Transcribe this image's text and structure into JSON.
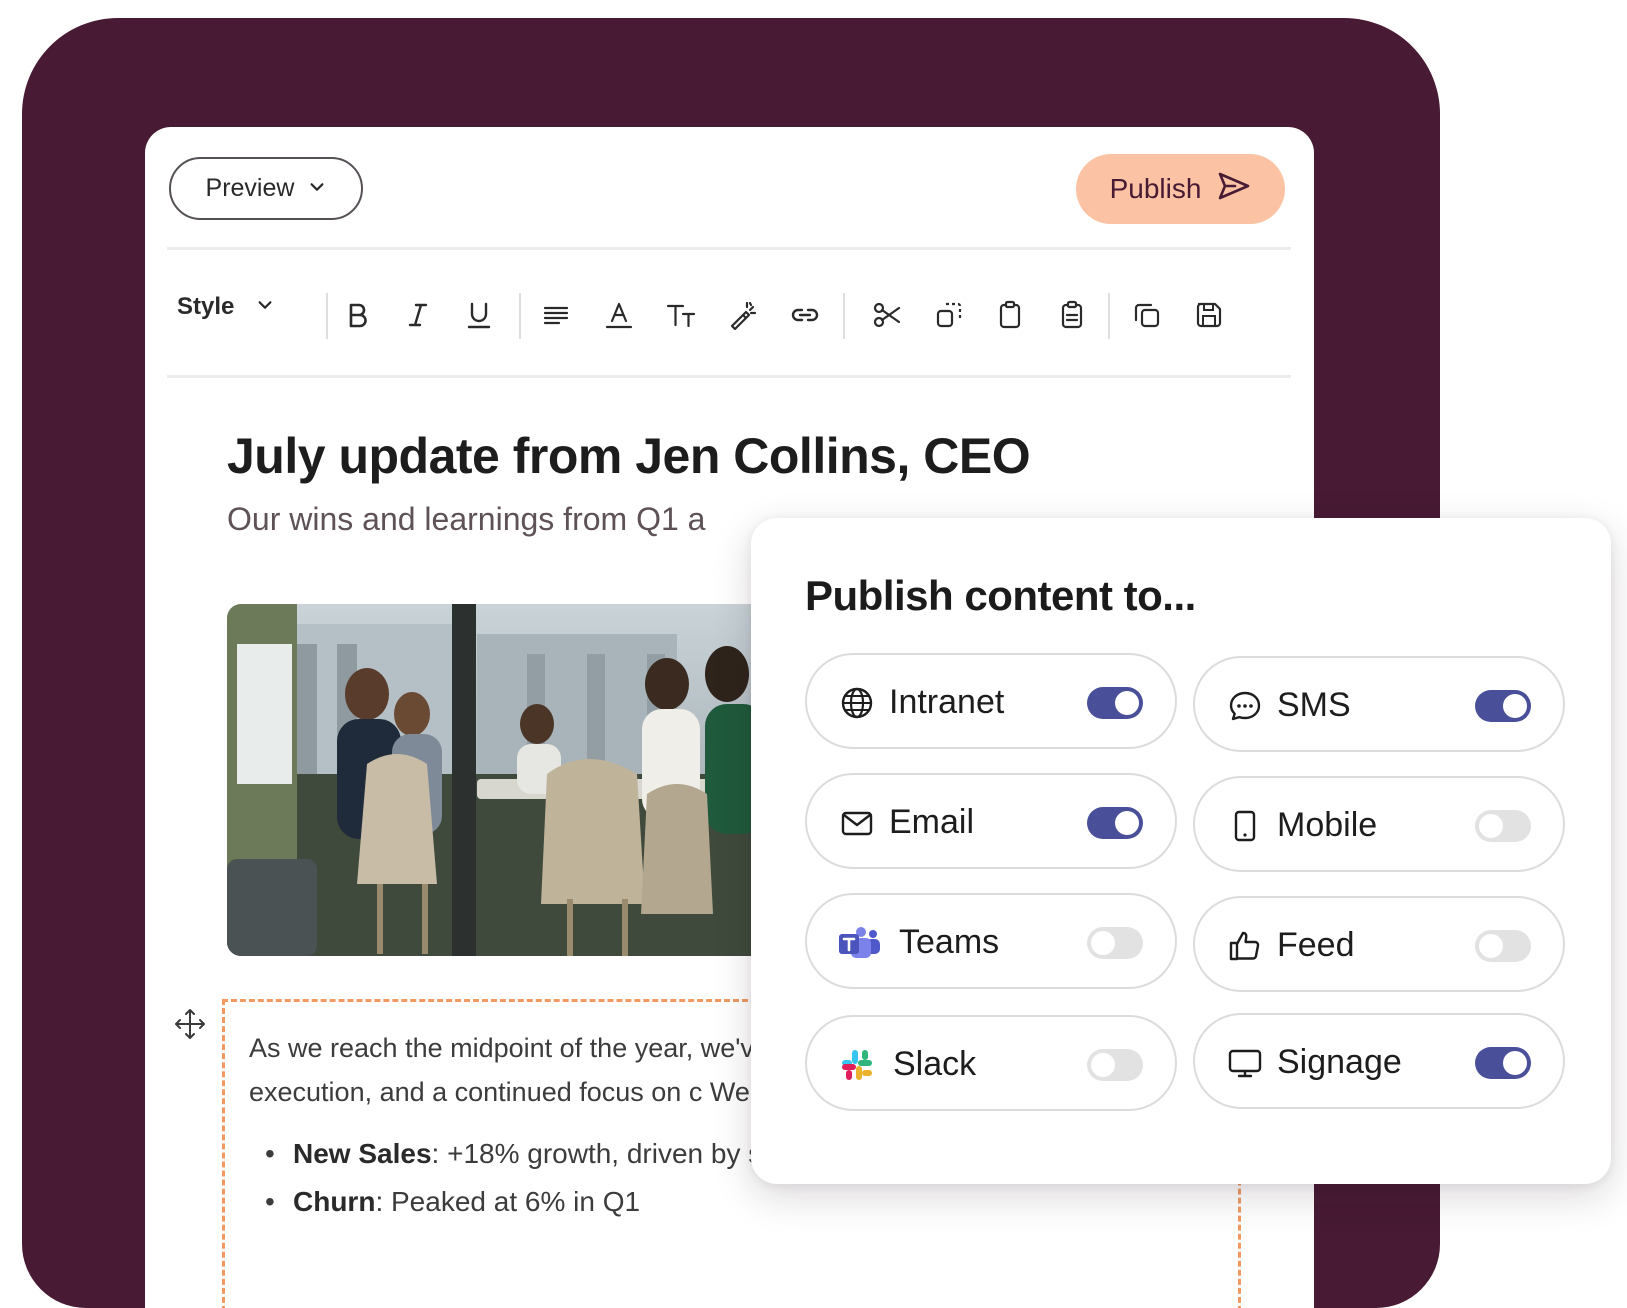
{
  "editor": {
    "preview_label": "Preview",
    "publish_label": "Publish",
    "style_label": "Style",
    "title": "July update from Jen Collins, CEO",
    "subtitle": "Our wins and learnings from Q1 a",
    "body_text": "As we reach the midpoint of the year, we've built across the business. Q2 ha execution, and a continued focus on c We've seen growth in key areas and stre",
    "bullets": [
      {
        "label": "New Sales",
        "text": ": +18% growth, driven by strong enterprise conversions"
      },
      {
        "label": "Churn",
        "text": ": Peaked at 6% in Q1"
      }
    ]
  },
  "toolbar_icons": [
    "bold-icon",
    "italic-icon",
    "underline-icon",
    "align-icon",
    "text-color-icon",
    "font-size-icon",
    "magic-wand-icon",
    "link-icon",
    "scissors-icon",
    "copy-frame-icon",
    "clipboard-icon",
    "clipboard-list-icon",
    "duplicate-icon",
    "save-icon"
  ],
  "publish_panel": {
    "title": "Publish content to...",
    "channels": [
      {
        "label": "Intranet",
        "icon": "globe-icon",
        "enabled": true
      },
      {
        "label": "SMS",
        "icon": "chat-bubble-icon",
        "enabled": true
      },
      {
        "label": "Email",
        "icon": "envelope-icon",
        "enabled": true
      },
      {
        "label": "Mobile",
        "icon": "phone-icon",
        "enabled": false
      },
      {
        "label": "Teams",
        "icon": "teams-logo-icon",
        "enabled": false
      },
      {
        "label": "Feed",
        "icon": "thumbs-up-icon",
        "enabled": false
      },
      {
        "label": "Slack",
        "icon": "slack-logo-icon",
        "enabled": false
      },
      {
        "label": "Signage",
        "icon": "monitor-icon",
        "enabled": true
      }
    ]
  },
  "colors": {
    "backdrop": "#481a34",
    "publish_button": "#fbc3a4",
    "toggle_on": "#4a4f9a",
    "toggle_off": "#e2e2e2",
    "selection_border": "#f09a61"
  }
}
